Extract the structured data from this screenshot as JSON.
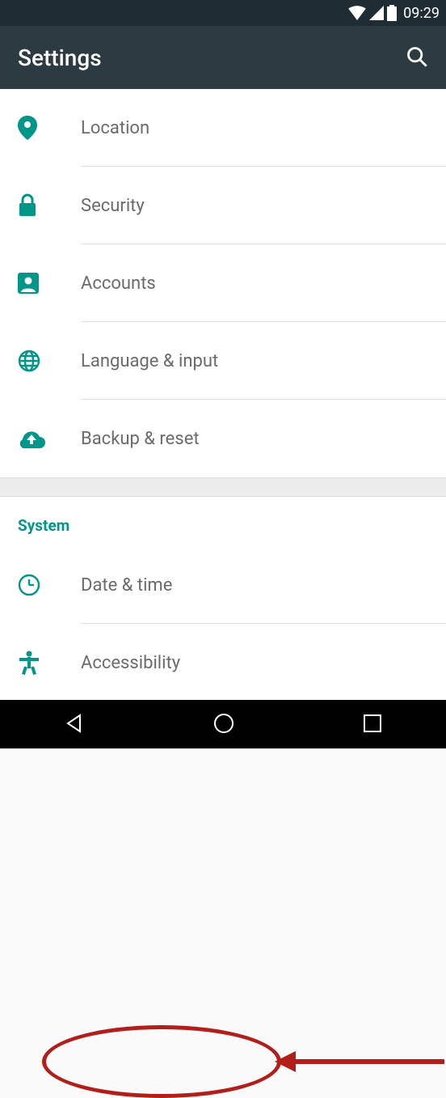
{
  "status": {
    "time": "09:29"
  },
  "app_bar": {
    "title": "Settings"
  },
  "list": {
    "items": [
      {
        "icon": "location-pin-icon",
        "label": "Location"
      },
      {
        "icon": "lock-icon",
        "label": "Security"
      },
      {
        "icon": "person-box-icon",
        "label": "Accounts"
      },
      {
        "icon": "globe-icon",
        "label": "Language & input"
      },
      {
        "icon": "cloud-up-icon",
        "label": "Backup & reset"
      }
    ]
  },
  "section": {
    "title": "System",
    "items": [
      {
        "icon": "clock-icon",
        "label": "Date & time"
      },
      {
        "icon": "accessibility-icon",
        "label": "Accessibility"
      }
    ]
  },
  "annotation": {
    "highlighted_item_index": 3,
    "color": "#b21f1a"
  }
}
